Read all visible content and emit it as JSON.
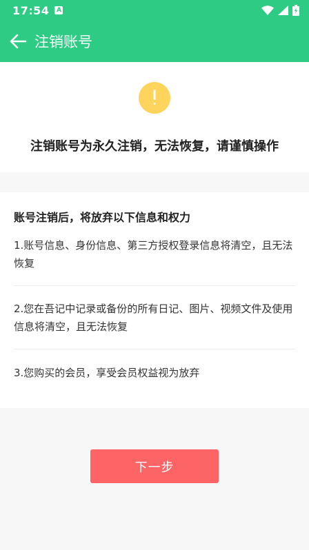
{
  "status_bar": {
    "time": "17:54",
    "icons": [
      "a-notification-icon",
      "wifi-icon",
      "signal-icon",
      "battery-icon"
    ]
  },
  "app_bar": {
    "title": "注销账号",
    "back_icon": "arrow-left-icon"
  },
  "warning": {
    "icon": "exclamation-circle-icon",
    "headline": "注销账号为永久注销，无法恢复，请谨慎操作"
  },
  "info": {
    "heading": "账号注销后，将放弃以下信息和权力",
    "items": [
      "1.账号信息、身份信息、第三方授权登录信息将清空，且无法恢复",
      "2.您在吾记中记录或备份的所有日记、图片、视频文件及使用信息将清空，且无法恢复",
      "3.您购买的会员，享受会员权益视为放弃"
    ]
  },
  "actions": {
    "next_label": "下一步"
  },
  "colors": {
    "primary": "#2ecb84",
    "warning": "#ffd45c",
    "button": "#fc6465"
  }
}
